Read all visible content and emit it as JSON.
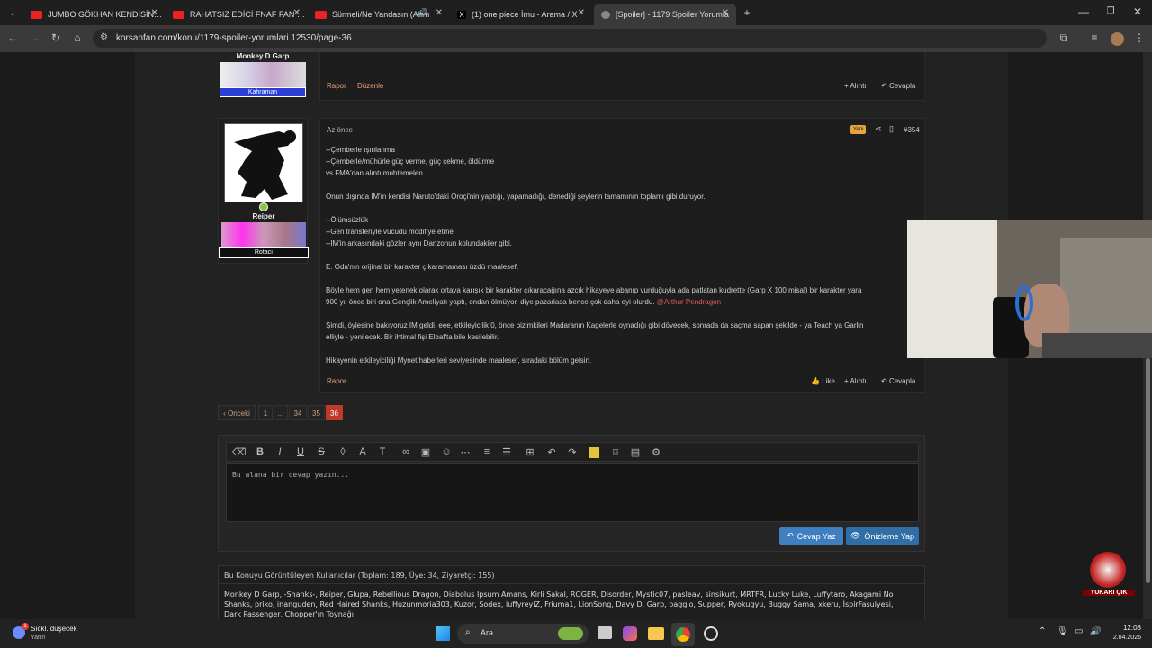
{
  "browser": {
    "tabs": [
      {
        "title": "JUMBO GÖKHAN KENDİSİNE İK",
        "favicon": "youtube-icon"
      },
      {
        "title": "RAHATSIZ EDİCİ FNAF FAN OYU",
        "favicon": "youtube-icon"
      },
      {
        "title": "Sürmeli/Ne Yandasın (Ahm",
        "favicon": "youtube-icon"
      },
      {
        "title": "(1) one piece İmu - Arama / X",
        "favicon": "x-icon"
      },
      {
        "title": "[Spoiler] - 1179 Spoiler Yorumla",
        "favicon": "forum-icon"
      }
    ],
    "url": "korsanfan.com/konu/1179-spoiler-yorumlari.12530/page-36"
  },
  "prev_post": {
    "username": "Monkey D Garp",
    "rank": "Kahraman",
    "actions": [
      "Rapor",
      "Düzenle"
    ],
    "quote_label": "+ Alıntı",
    "reply_label": "Cevapla"
  },
  "post": {
    "username": "Reiper",
    "rank": "Rotacı",
    "time": "Az önce",
    "badge": "Yeni",
    "number": "#354",
    "lines": [
      "--Çemberle ışınlanma",
      "--Çemberle/mühürle güç verme, güç çekme, öldürme",
      "vs FMA'dan alıntı muhtemelen.",
      "",
      "Onun dışında IM'ın kendisi Naruto'daki Oroçi'nin yaptığı, yapamadığı, denediği şeylerin tamamının toplamı gibi duruyor.",
      "",
      "--Ölümsüzlük",
      "--Gen transferiyle vücudu modifiye etme",
      "--IM'in arkasındaki gözler aynı Danzonun kolundakiler gibi.",
      "",
      "E. Oda'nın orijinal bir karakter çıkaramaması üzdü maalesef.",
      "",
      "Böyle hem gen hem yetenek olarak ortaya karışık bir karakter çıkaracağına azcık hikayeye abanıp vurduğuyla ada patlatan kudrette (Garp X 100 misal) bir karakter yara",
      "900 yıl önce biri ona Gençlik Ameliyatı yaptı, ondan ölmüyor, diye pazarlasa bence çok daha eyi olurdu.",
      "",
      "Şimdi, öylesine bakıyoruz IM geldi, eee, etkileyicilik 0, önce bizimkileri Madaranın Kagelerle oynadığı gibi dövecek, sonrada da saçma sapan şekilde - ya Teach ya Garlin",
      "elliyle - yenilecek. Bir ihtimal fişi Elbaf'ta bile kesilebilir.",
      "",
      "Hikayenin etkileyiciliği Mynet haberleri seviyesinde maalesef, sıradaki bölüm gelsin."
    ],
    "mention": "@Arthur Pendragon",
    "report_label": "Rapor",
    "like_label": "Like",
    "quote_label": "+ Alıntı",
    "reply_label": "Cevapla"
  },
  "pagination": {
    "prev_label": "‹ Önceki",
    "pages": [
      "1",
      "...",
      "34",
      "35",
      "36"
    ],
    "current": "36"
  },
  "editor": {
    "placeholder": "Bu alana bir cevap yazın...",
    "submit_label": "Cevap Yaz",
    "preview_label": "Önizleme Yap"
  },
  "viewers": {
    "title": "Bu Konuyu Görüntüleyen Kullanıcılar (Toplam: 189, Üye: 34, Ziyaretçi: 155)",
    "line1": "Monkey D Garp, -Shanks-, Reiper, Glupa, Rebellious Dragon, Diabolus Ipsum Amans, Kirli Sakal, ROGER, Disorder, Mystic07, pasleav, sinsikurt, MRTFR, Lucky Luke, Luffytaro, Akagami No",
    "line2": "Shanks, priko, inanguden, Red Haired Shanks, Huzunmoria303, Kuzor, Sodex, luffyreyiZ, Friuma1, LionSong, Davy D. Garp, baggio, Supper, Ryokugyu, Buggy Sama, xkeru, İspirFasulyesi,",
    "line3": "Dark Passenger, Chopper'ın Toynağı"
  },
  "scroll_top_label": "YUKARI ÇIK",
  "taskbar": {
    "weather": "Sıckl. düşecek",
    "weather_sub": "Yarın",
    "weather_badge": "1",
    "search": "Ara",
    "time": "12:08",
    "date": "2.04.2026"
  },
  "colors": {
    "accent_link": "#e8a07a",
    "rank_blue": "#2a3fd6",
    "badge_yellow": "#e6a23c",
    "button_blue": "#2f6fa6",
    "page_active": "#c0392b"
  }
}
